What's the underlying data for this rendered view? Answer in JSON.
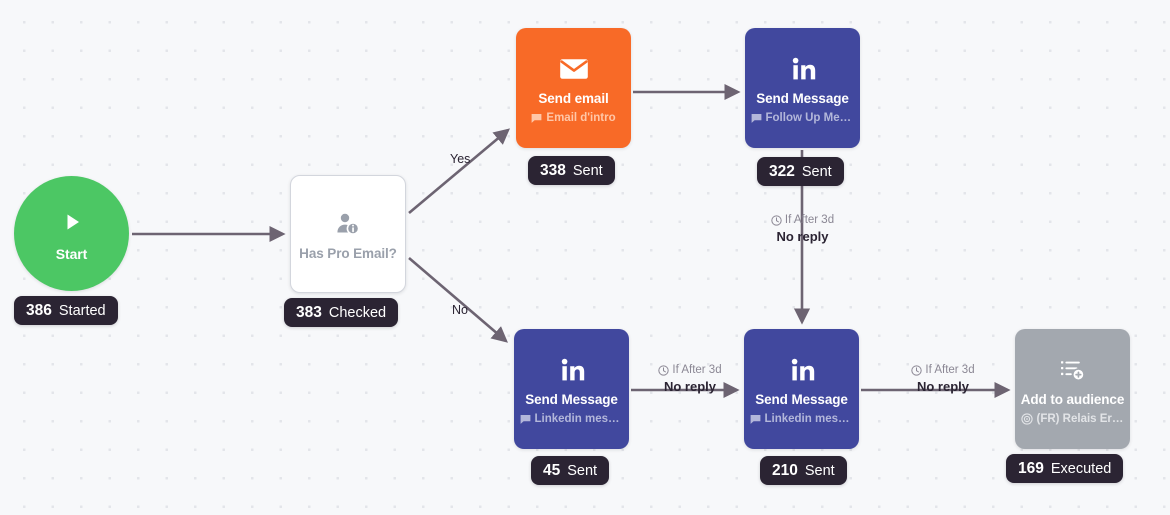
{
  "canvas": {
    "background_color": "#f7f8fa",
    "dot_color": "#e3e5ea"
  },
  "colors": {
    "start_green": "#4cc764",
    "email_orange": "#f86a27",
    "linkedin_blue": "#41489e",
    "audience_gray": "#a3a8af",
    "badge_dark": "#2b2433",
    "edge_gray": "#6d6472",
    "decision_border": "#d3d6dd",
    "decision_text": "#9aa0ab"
  },
  "nodes": {
    "start": {
      "title": "Start",
      "icon": "play-icon",
      "badge": {
        "value": "386",
        "label": "Started"
      }
    },
    "decision": {
      "title": "Has Pro Email?",
      "icon": "person-info-icon",
      "badge": {
        "value": "383",
        "label": "Checked"
      }
    },
    "send_email": {
      "title": "Send email",
      "subtitle": "Email d'intro",
      "subtitle_icon": "message-flag-icon",
      "icon": "envelope-icon",
      "badge": {
        "value": "338",
        "label": "Sent"
      }
    },
    "follow_up_message": {
      "title": "Send Message",
      "subtitle": "Follow Up Mess...",
      "subtitle_icon": "message-flag-icon",
      "icon": "linkedin-icon",
      "badge": {
        "value": "322",
        "label": "Sent"
      }
    },
    "linkedin_first": {
      "title": "Send Message",
      "subtitle": "Linkedin messa...",
      "subtitle_icon": "message-flag-icon",
      "icon": "linkedin-icon",
      "badge": {
        "value": "45",
        "label": "Sent"
      }
    },
    "linkedin_second": {
      "title": "Send Message",
      "subtitle": "Linkedin messa...",
      "subtitle_icon": "message-flag-icon",
      "icon": "linkedin-icon",
      "badge": {
        "value": "210",
        "label": "Sent"
      }
    },
    "add_to_audience": {
      "title": "Add to audience",
      "subtitle": "(FR) Relais Eric ...",
      "subtitle_icon": "audience-target-icon",
      "icon": "list-add-icon",
      "badge": {
        "value": "169",
        "label": "Executed"
      }
    }
  },
  "edges": {
    "branch_yes": "Yes",
    "branch_no": "No",
    "delay_vertical": {
      "condition": "If After 3d",
      "reply": "No reply",
      "icon": "clock-icon"
    },
    "delay_middle": {
      "condition": "If After 3d",
      "reply": "No reply",
      "icon": "clock-icon"
    },
    "delay_right": {
      "condition": "If After 3d",
      "reply": "No reply",
      "icon": "clock-icon"
    }
  }
}
